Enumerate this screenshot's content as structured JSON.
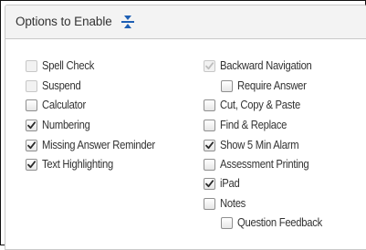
{
  "panel": {
    "title": "Options to Enable",
    "collapse_icon": "collapse-vertical-icon"
  },
  "left_options": [
    {
      "label": "Spell Check",
      "checked": false,
      "disabled": true
    },
    {
      "label": "Suspend",
      "checked": false,
      "disabled": true
    },
    {
      "label": "Calculator",
      "checked": false,
      "disabled": false
    },
    {
      "label": "Numbering",
      "checked": true,
      "disabled": false
    },
    {
      "label": "Missing Answer Reminder",
      "checked": true,
      "disabled": false
    },
    {
      "label": "Text Highlighting",
      "checked": true,
      "disabled": false
    }
  ],
  "right_options": [
    {
      "label": "Backward Navigation",
      "checked": true,
      "disabled": true
    },
    {
      "label": "Require Answer",
      "checked": false,
      "disabled": false
    },
    {
      "label": "Cut, Copy & Paste",
      "checked": false,
      "disabled": false
    },
    {
      "label": "Find & Replace",
      "checked": false,
      "disabled": false
    },
    {
      "label": "Show 5 Min Alarm",
      "checked": true,
      "disabled": false
    },
    {
      "label": "Assessment Printing",
      "checked": false,
      "disabled": false
    },
    {
      "label": "iPad",
      "checked": true,
      "disabled": false
    },
    {
      "label": "Notes",
      "checked": false,
      "disabled": false
    },
    {
      "label": "Question Feedback",
      "checked": false,
      "disabled": false
    }
  ],
  "colors": {
    "header_bg": "#f3f3f3",
    "icon_blue": "#1e5fb4",
    "check_dark": "#2a2a2a",
    "check_disabled": "#bdbdbd",
    "text": "#333333"
  }
}
